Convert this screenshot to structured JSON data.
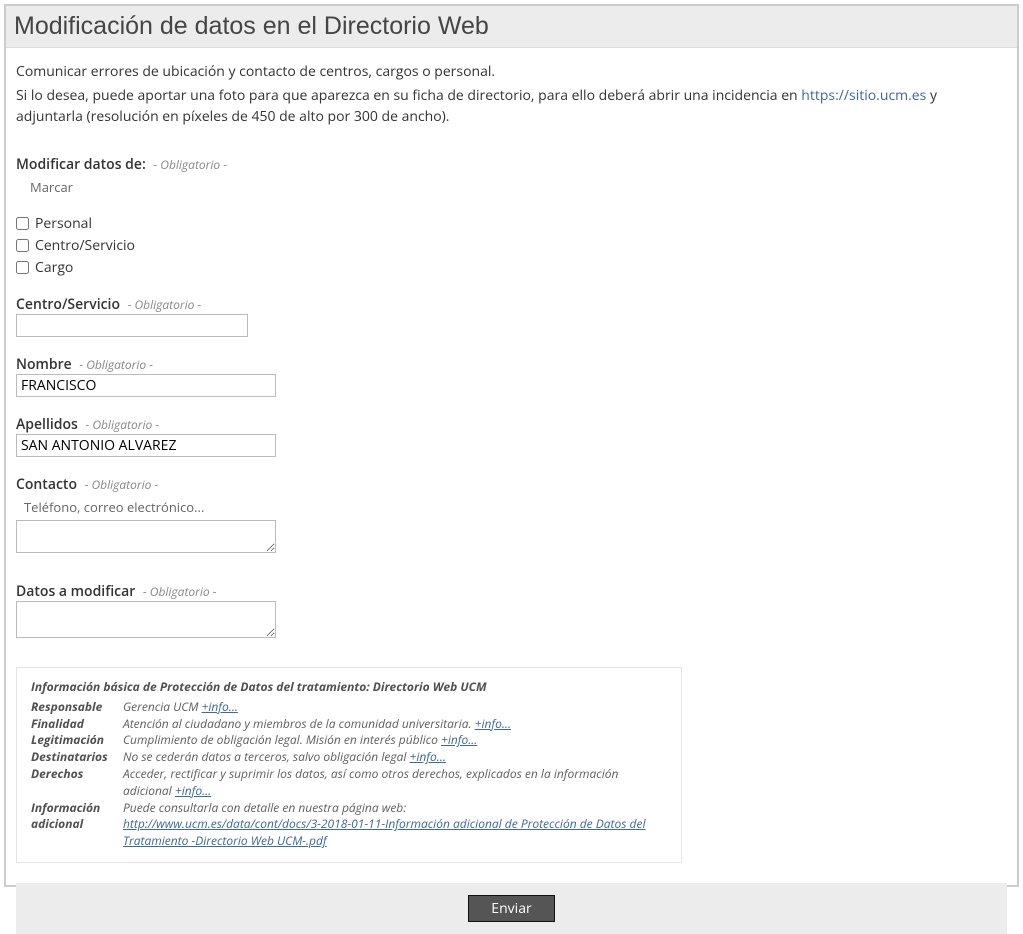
{
  "title": "Modificación de datos en el Directorio Web",
  "intro": {
    "line1": "Comunicar errores de ubicación y contacto de centros, cargos o personal.",
    "line2a": "Si lo desea, puede aportar una foto para que aparezca en su ficha de directorio, para ello deberá abrir una incidencia en ",
    "link_text": "https://sitio.ucm.es",
    "line2b": " y adjuntarla (resolución en píxeles de 450 de alto por 300 de ancho)."
  },
  "obligatorio_hint": "- Obligatorio -",
  "modify": {
    "label": "Modificar datos de:",
    "marcar": "Marcar",
    "options": {
      "personal": "Personal",
      "centro": "Centro/Servicio",
      "cargo": "Cargo"
    }
  },
  "centro": {
    "label": "Centro/Servicio",
    "value": ""
  },
  "nombre": {
    "label": "Nombre",
    "value": "FRANCISCO"
  },
  "apellidos": {
    "label": "Apellidos",
    "value": "SAN ANTONIO ALVAREZ"
  },
  "contacto": {
    "label": "Contacto",
    "sub": "Teléfono, correo electrónico...",
    "value": ""
  },
  "datos": {
    "label": "Datos a modificar",
    "value": ""
  },
  "dp": {
    "title": "Información básica de Protección de Datos del tratamiento: Directorio Web UCM",
    "plusinfo": "+info...",
    "rows": {
      "responsable_k": "Responsable",
      "responsable_v": "Gerencia UCM  ",
      "finalidad_k": "Finalidad",
      "finalidad_v": "Atención al ciudadano y miembros de la comunidad universitaria.  ",
      "legitimacion_k": "Legitimación",
      "legitimacion_v": "Cumplimiento de obligación legal. Misión en interés público  ",
      "destinatarios_k": "Destinatarios",
      "destinatarios_v": "No se cederán datos a terceros, salvo obligación legal  ",
      "derechos_k": "Derechos",
      "derechos_v": "Acceder, rectificar y suprimir los datos, así como otros derechos, explicados en la información adicional  ",
      "info_k": "Información adicional",
      "info_v": "Puede consultarla con detalle en nuestra página web:",
      "info_link": "http://www.ucm.es/data/cont/docs/3-2018-01-11-Información adicional de Protección de Datos del Tratamiento -Directorio Web UCM-.pdf"
    }
  },
  "submit": "Enviar"
}
